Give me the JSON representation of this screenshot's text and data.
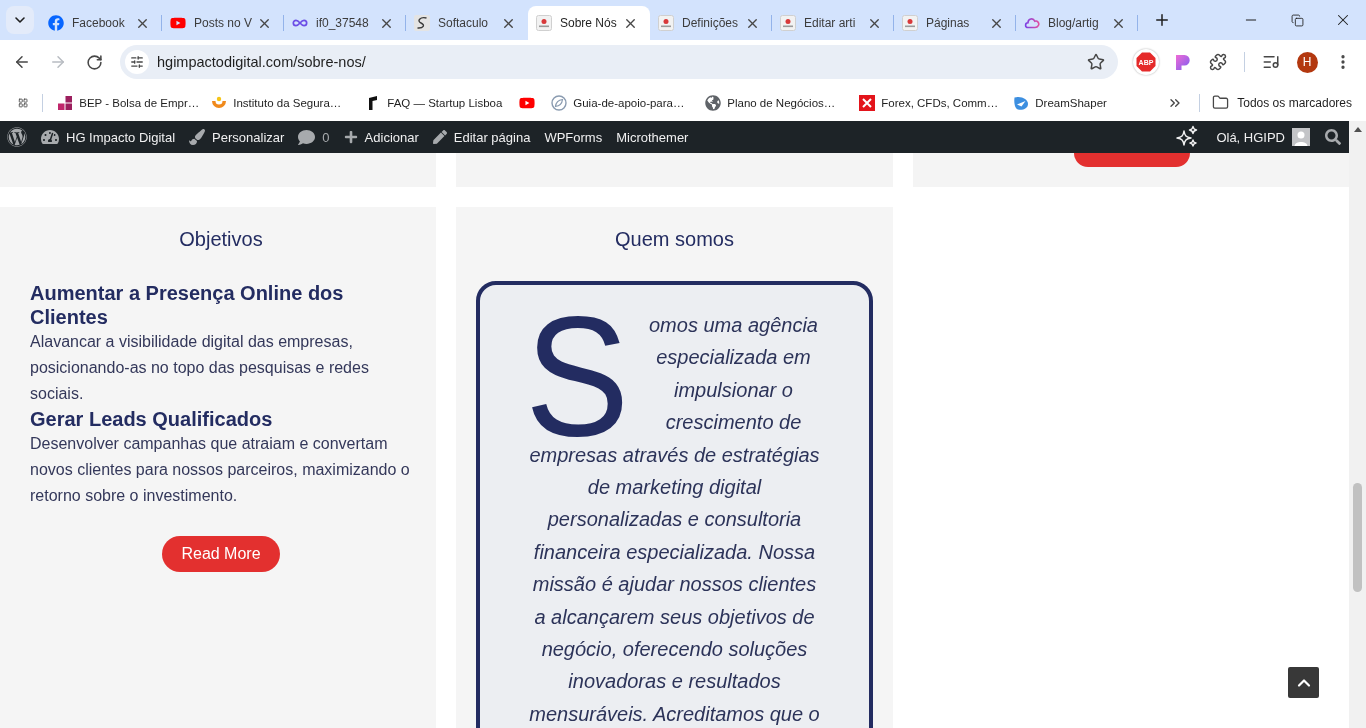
{
  "browser": {
    "tabs": [
      {
        "title": "Facebook",
        "selected": false
      },
      {
        "title": "Posts no V",
        "selected": false
      },
      {
        "title": "if0_37548",
        "selected": false
      },
      {
        "title": "Softaculo",
        "selected": false
      },
      {
        "title": "Sobre Nós",
        "selected": true
      },
      {
        "title": "Definições",
        "selected": false
      },
      {
        "title": "Editar arti",
        "selected": false
      },
      {
        "title": "Páginas",
        "selected": false
      },
      {
        "title": "Blog/artig",
        "selected": false
      }
    ],
    "back_button": {
      "disabled": false
    },
    "forward_button": {
      "disabled": true
    },
    "address": "hgimpactodigital.com/sobre-nos/",
    "extension_badge": "ABP",
    "profile_initial": "H",
    "bookmarks": [
      {
        "kind": "link",
        "label": "BEP - Bolsa de Empr…"
      },
      {
        "kind": "link",
        "label": "Instituto da Segura…"
      },
      {
        "kind": "link",
        "label": "FAQ — Startup Lisboa"
      },
      {
        "kind": "icon"
      },
      {
        "kind": "link",
        "label": "Guia-de-apoio-para…"
      },
      {
        "kind": "link",
        "label": "Plano de Negócios…"
      },
      {
        "kind": "link",
        "label": "Forex, CFDs, Comm…"
      },
      {
        "kind": "link",
        "label": "DreamShaper"
      }
    ],
    "all_bookmarks": "Todos os marcadores"
  },
  "admin_bar": {
    "items": [
      {
        "kind": "menu",
        "label": "HG Impacto Digital"
      },
      {
        "kind": "menu",
        "label": "Personalizar"
      },
      {
        "kind": "count",
        "label": "0"
      },
      {
        "kind": "menu",
        "label": "Adicionar"
      },
      {
        "kind": "menu",
        "label": "Editar página"
      },
      {
        "kind": "menu",
        "label": "WPForms"
      },
      {
        "kind": "menu",
        "label": "Microthemer"
      }
    ],
    "greeting": "Olá, HGIPD"
  },
  "page": {
    "objectives": {
      "title": "Objetivos",
      "items": [
        {
          "heading": "Aumentar a Presença Online dos Clientes",
          "text": "Alavancar a visibilidade digital das empresas, posicionando-as no topo das pesquisas e redes sociais."
        },
        {
          "heading": "Gerar Leads Qualificados",
          "text": "Desenvolver campanhas que atraiam e convertam novos clientes para nossos parceiros, maximizando o retorno sobre o investimento."
        }
      ],
      "button": "Read More"
    },
    "about": {
      "title": "Quem somos",
      "drop_cap": "S",
      "lines": [
        "omos uma agência",
        "especializada em",
        "impulsionar o",
        "crescimento de",
        "empresas através de estratégias",
        "de marketing digital",
        "personalizadas e consultoria",
        "financeira especializada. Nossa",
        "missão é ajudar nossos clientes",
        "a alcançarem seus objetivos de",
        "negócio, oferecendo soluções",
        "inovadoras e resultados",
        "mensuráveis. Acreditamos que o"
      ]
    }
  }
}
